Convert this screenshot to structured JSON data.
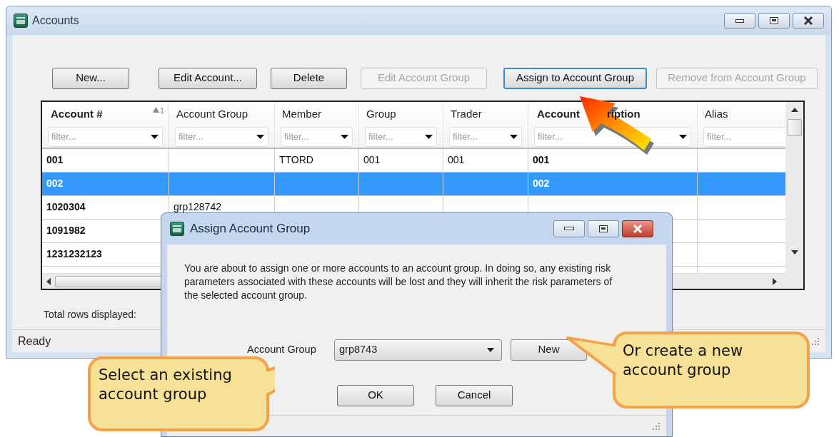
{
  "window": {
    "title": "Accounts"
  },
  "toolbar": {
    "buttons": [
      {
        "label": "New...",
        "disabled": false,
        "focused": false
      },
      {
        "label": "Edit Account...",
        "disabled": false,
        "focused": false
      },
      {
        "label": "Delete",
        "disabled": false,
        "focused": false
      },
      {
        "label": "Edit Account Group",
        "disabled": true,
        "focused": false
      },
      {
        "label": "Assign to Account Group",
        "disabled": false,
        "focused": true
      },
      {
        "label": "Remove from Account Group",
        "disabled": true,
        "focused": false
      }
    ]
  },
  "table": {
    "columns": [
      {
        "label": "Account #",
        "bold": true,
        "sort": "1",
        "placeholder": "filter..."
      },
      {
        "label": "Account Group",
        "bold": false,
        "placeholder": "filter..."
      },
      {
        "label": "Member",
        "bold": false,
        "placeholder": "filter..."
      },
      {
        "label": "Group",
        "bold": false,
        "placeholder": "filter..."
      },
      {
        "label": "Trader",
        "bold": false,
        "placeholder": "filter..."
      },
      {
        "label": "Account",
        "label_tail": "ription",
        "bold": true,
        "placeholder": "filter..."
      },
      {
        "label": "Alias",
        "bold": false,
        "placeholder": "filter...",
        "dropdown": false
      }
    ],
    "rows": [
      {
        "selected": false,
        "cells": [
          "001",
          "",
          "TTORD",
          "001",
          "001",
          "001",
          ""
        ]
      },
      {
        "selected": true,
        "cells": [
          "002",
          "",
          "",
          "",
          "",
          "002",
          ""
        ]
      },
      {
        "selected": false,
        "cells": [
          "1020304",
          "grp128742",
          "",
          "",
          "",
          "",
          ""
        ]
      },
      {
        "selected": false,
        "cells": [
          "1091982",
          "",
          "",
          "",
          "",
          "",
          ""
        ]
      },
      {
        "selected": false,
        "cells": [
          "1231232123",
          "",
          "",
          "",
          "",
          "",
          ""
        ]
      }
    ]
  },
  "footer_label": "Total rows displayed:",
  "status_bar": "Ready",
  "dialog": {
    "title": "Assign Account Group",
    "message": "You are about to assign one or more accounts to an account group. In doing so, any existing risk parameters associated with these accounts will be lost and they will inherit the risk parameters of the selected account group.",
    "field": {
      "label": "Account Group",
      "value": "grp8743"
    },
    "new_button": "New",
    "buttons": [
      "OK",
      "Cancel"
    ]
  },
  "callouts": [
    {
      "text": "Select an existing account group"
    },
    {
      "text": "Or create a new account group"
    }
  ]
}
